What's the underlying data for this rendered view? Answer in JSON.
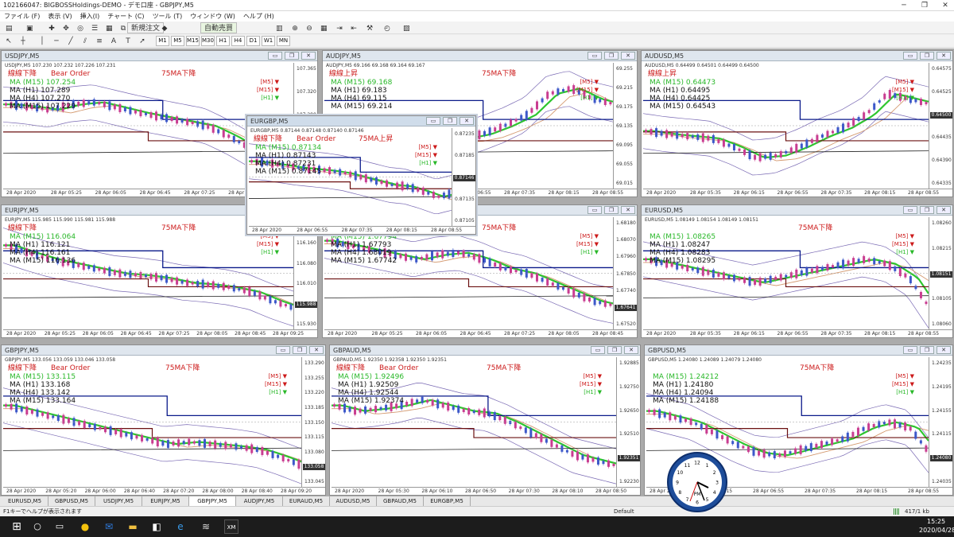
{
  "app": {
    "title": "102166047: BIGBOSSHoldings-DEMO - デモ口座 - GBPJPY,M5",
    "win_min": "─",
    "win_max": "❐",
    "win_close": "✕"
  },
  "menu": [
    "ファイル (F)",
    "表示 (V)",
    "挿入(I)",
    "チャート (C)",
    "ツール (T)",
    "ウィンドウ (W)",
    "ヘルプ (H)"
  ],
  "toolbar": {
    "new_order": "新規注文",
    "auto_trade": "自動売買",
    "timeframes": [
      "M1",
      "M5",
      "M15",
      "M30",
      "H1",
      "H4",
      "D1",
      "W1",
      "MN"
    ]
  },
  "charts": [
    {
      "id": "usdjpy",
      "title": "USDJPY,M5",
      "sym": "USDJPY,M5  107.230 107.232 107.226 107.231",
      "trend": "線線下降",
      "order": "Bear Order",
      "ma75": "75MA下降",
      "ma": [
        "MA (M15) 107.254",
        "MA (H1) 107.289",
        "MA (H4) 107.270",
        "MA (M15) 107.229"
      ],
      "yticks": [
        "107.365",
        "107.320",
        "107.280",
        "107.231",
        "107.195",
        "107.160"
      ],
      "price": "107.231",
      "xticks": [
        "28 Apr 2020",
        "28 Apr 05:25",
        "28 Apr 06:05",
        "28 Apr 06:45",
        "28 Apr 07:25",
        "28 Apr 08:05",
        "28 Apr 08:45"
      ]
    },
    {
      "id": "audjpy",
      "title": "AUDJPY,M5",
      "sym": "AUDJPY,M5  69.166 69.168 69.164 69.167",
      "trend": "線線上昇",
      "order": "",
      "ma75": "75MA下降",
      "ma": [
        "MA (M15) 69.168",
        "MA (H1) 69.183",
        "MA (H4) 69.115",
        "MA (M15) 69.214"
      ],
      "yticks": [
        "69.255",
        "69.215",
        "69.175",
        "69.135",
        "69.095",
        "69.055",
        "69.015"
      ],
      "price": "69.167",
      "xticks": [
        "28 Apr 2020",
        "28 Apr 05:35",
        "28 Apr 06:15",
        "28 Apr 06:55",
        "28 Apr 07:35",
        "28 Apr 08:15",
        "28 Apr 08:55"
      ]
    },
    {
      "id": "audusd",
      "title": "AUDUSD,M5",
      "sym": "AUDUSD,M5  0.64499 0.64501 0.64499 0.64500",
      "trend": "線線上昇",
      "order": "",
      "ma75": "",
      "ma": [
        "MA (M15) 0.64473",
        "MA (H1) 0.64495",
        "MA (H4) 0.64425",
        "MA (M15) 0.64543"
      ],
      "yticks": [
        "0.64575",
        "0.64525",
        "0.64500",
        "0.64435",
        "0.64390",
        "0.64335"
      ],
      "price": "0.64500",
      "xticks": [
        "28 Apr 2020",
        "28 Apr 05:35",
        "28 Apr 06:15",
        "28 Apr 06:55",
        "28 Apr 07:35",
        "28 Apr 08:15",
        "28 Apr 08:55"
      ]
    },
    {
      "id": "eurjpy",
      "title": "EURJPY,M5",
      "sym": "EURJPY,M5  115.985 115.990 115.981 115.988",
      "trend": "線線下降",
      "order": "",
      "ma75": "75MA下降",
      "ma": [
        "MA (M15) 116.064",
        "MA (H1) 116.121",
        "MA (H4) 116.161",
        "MA (M15) 116.136"
      ],
      "yticks": [
        "116.230",
        "116.160",
        "116.080",
        "116.010",
        "115.988",
        "115.930"
      ],
      "price": "115.988",
      "xticks": [
        "28 Apr 2020",
        "28 Apr 05:25",
        "28 Apr 06:05",
        "28 Apr 06:45",
        "28 Apr 07:25",
        "28 Apr 08:05",
        "28 Apr 08:45",
        "28 Apr 09:25"
      ]
    },
    {
      "id": "eurgbp",
      "title": "EURGBP,M5",
      "sym": "EURGBP,M5  0.87144 0.87148 0.87140 0.87146",
      "trend": "線線下降",
      "order": "Bear Order",
      "ma75": "75MA上昇",
      "ma": [
        "MA (M15) 0.87134",
        "MA (H1) 0.87143",
        "MA (H4) 0.87231",
        "MA (M15) 0.87145"
      ],
      "yticks": [
        "0.87235",
        "0.87185",
        "0.87146",
        "0.87135",
        "0.87105"
      ],
      "price": "0.87146",
      "xticks": [
        "28 Apr 2020",
        "28 Apr 06:55",
        "28 Apr 07:35",
        "28 Apr 08:15",
        "28 Apr 08:55"
      ]
    },
    {
      "id": "euraud",
      "title": "EURAUD,M5",
      "sym": "EURAUD,M5",
      "trend": "",
      "order": "",
      "ma75": "75MA下降",
      "ma": [
        "MA (M15) 1.67794",
        "MA (H1) 1.67793",
        "MA (H4) 1.68019",
        "MA (M15) 1.67742"
      ],
      "yticks": [
        "1.68180",
        "1.68070",
        "1.67960",
        "1.67850",
        "1.67740",
        "1.67641",
        "1.67520"
      ],
      "price": "1.67641",
      "xticks": [
        "28 Apr 2020",
        "28 Apr 05:25",
        "28 Apr 06:05",
        "28 Apr 06:45",
        "28 Apr 07:25",
        "28 Apr 08:05",
        "28 Apr 08:45"
      ]
    },
    {
      "id": "eurusd",
      "title": "EURUSD,M5",
      "sym": "EURUSD,M5  1.08149 1.08154 1.08149 1.08151",
      "trend": "",
      "order": "",
      "ma75": "75MA下降",
      "ma": [
        "MA (M15) 1.08265",
        "MA (H1) 1.08247",
        "MA (H4) 1.08283",
        "MA (M15) 1.08295"
      ],
      "yticks": [
        "1.08260",
        "1.08215",
        "1.08151",
        "1.08105",
        "1.08060"
      ],
      "price": "1.08151",
      "xticks": [
        "28 Apr 2020",
        "28 Apr 05:35",
        "28 Apr 06:15",
        "28 Apr 06:55",
        "28 Apr 07:35",
        "28 Apr 08:15",
        "28 Apr 08:55"
      ]
    },
    {
      "id": "gbpjpy",
      "title": "GBPJPY,M5",
      "sym": "GBPJPY,M5  133.056 133.059 133.046 133.058",
      "trend": "線線下降",
      "order": "Bear Order",
      "ma75": "75MA下降",
      "ma": [
        "MA (M15) 133.115",
        "MA (H1) 133.168",
        "MA (H4) 133.142",
        "MA (M15) 133.164"
      ],
      "yticks": [
        "133.290",
        "133.255",
        "133.220",
        "133.185",
        "133.150",
        "133.115",
        "133.080",
        "133.058",
        "133.045"
      ],
      "price": "133.058",
      "xticks": [
        "28 Apr 2020",
        "28 Apr 05:20",
        "28 Apr 06:00",
        "28 Apr 06:40",
        "28 Apr 07:20",
        "28 Apr 08:00",
        "28 Apr 08:40",
        "28 Apr 09:20"
      ]
    },
    {
      "id": "gbpaud",
      "title": "GBPAUD,M5",
      "sym": "GBPAUD,M5  1.92350 1.92358 1.92350 1.92351",
      "trend": "線線下降",
      "order": "Bear Order",
      "ma75": "75MA下降",
      "ma": [
        "MA (M15) 1.92496",
        "MA (H1) 1.92509",
        "MA (H4) 1.92544",
        "MA (M15) 1.92374"
      ],
      "yticks": [
        "1.92885",
        "1.92750",
        "1.92650",
        "1.92510",
        "1.92351",
        "1.92230"
      ],
      "price": "1.92351",
      "xticks": [
        "28 Apr 2020",
        "28 Apr 05:30",
        "28 Apr 06:10",
        "28 Apr 06:50",
        "28 Apr 07:30",
        "28 Apr 08:10",
        "28 Apr 08:50"
      ]
    },
    {
      "id": "gbpusd",
      "title": "GBPUSD,M5",
      "sym": "GBPUSD,M5  1.24080 1.24089 1.24079 1.24080",
      "trend": "",
      "order": "",
      "ma75": "75MA下降",
      "ma": [
        "MA (M15) 1.24212",
        "MA (H1) 1.24180",
        "MA (H4) 1.24094",
        "MA (M15) 1.24188"
      ],
      "yticks": [
        "1.24235",
        "1.24195",
        "1.24155",
        "1.24115",
        "1.24080",
        "1.24035"
      ],
      "price": "1.24080",
      "xticks": [
        "28 Apr 2020",
        "28 Apr 06:15",
        "28 Apr 06:55",
        "28 Apr 07:35",
        "28 Apr 08:15",
        "28 Apr 08:55"
      ]
    }
  ],
  "tf_labels": [
    "[M5]",
    "[M15]",
    "[H1]"
  ],
  "tabs": [
    "EURUSD,M5",
    "GBPUSD,M5",
    "USDJPY,M5",
    "EURJPY,M5",
    "GBPJPY,M5",
    "AUDJPY,M5",
    "EURAUD,M5",
    "AUDUSD,M5",
    "GBPAUD,M5",
    "EURGBP,M5"
  ],
  "active_tab": "GBPJPY,M5",
  "status": {
    "help": "F1キーでヘルプが表示されます",
    "profile": "Default",
    "traffic": "417/1 kb"
  },
  "clock": {
    "label": "PM",
    "time": "15:25",
    "date": "2020/04/28"
  },
  "colors": {
    "bull": "#3d58c9",
    "bear": "#c93d91",
    "ma_green": "#2ec62e",
    "ma_navy": "#0a1a8a",
    "ma_maroon": "#6b1010",
    "ma_brown": "#d49a70",
    "band": "#7a6ab4"
  }
}
